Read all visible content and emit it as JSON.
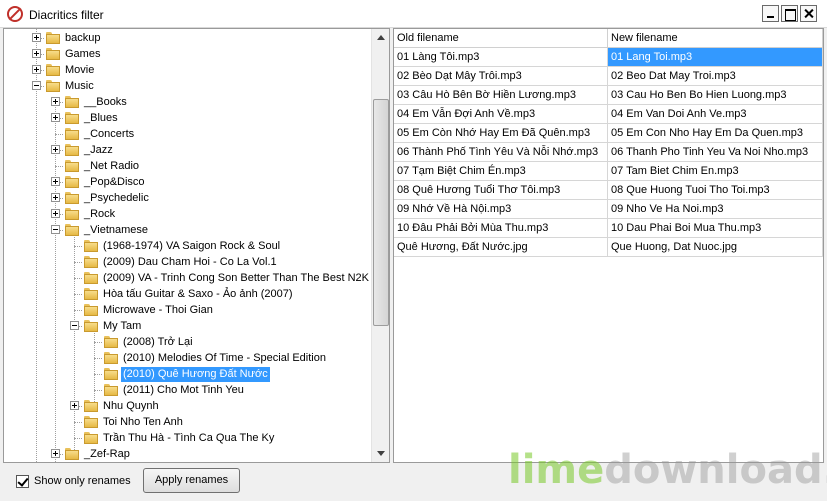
{
  "window": {
    "title": "Diacritics filter"
  },
  "colors": {
    "selection": "#3399ff",
    "folder": "#e6b945"
  },
  "tree": {
    "nodes": [
      {
        "label": "backup",
        "level": 1,
        "expander": "plus"
      },
      {
        "label": "Games",
        "level": 1,
        "expander": "plus"
      },
      {
        "label": "Movie",
        "level": 1,
        "expander": "plus"
      },
      {
        "label": "Music",
        "level": 1,
        "expander": "minus"
      },
      {
        "label": "__Books",
        "level": 2,
        "expander": "plus"
      },
      {
        "label": "_Blues",
        "level": 2,
        "expander": "plus"
      },
      {
        "label": "_Concerts",
        "level": 2,
        "expander": "none"
      },
      {
        "label": "_Jazz",
        "level": 2,
        "expander": "plus"
      },
      {
        "label": "_Net Radio",
        "level": 2,
        "expander": "none"
      },
      {
        "label": "_Pop&Disco",
        "level": 2,
        "expander": "plus"
      },
      {
        "label": "_Psychedelic",
        "level": 2,
        "expander": "plus"
      },
      {
        "label": "_Rock",
        "level": 2,
        "expander": "plus"
      },
      {
        "label": "_Vietnamese",
        "level": 2,
        "expander": "minus"
      },
      {
        "label": "(1968-1974) VA Saigon Rock & Soul",
        "level": 3,
        "expander": "none"
      },
      {
        "label": "(2009) Dau Cham Hoi - Co La Vol.1",
        "level": 3,
        "expander": "none"
      },
      {
        "label": "(2009) VA - Trinh Cong Son Better Than The Best N2K",
        "level": 3,
        "expander": "none"
      },
      {
        "label": "Hòa tấu Guitar & Saxo - Ảo ảnh (2007)",
        "level": 3,
        "expander": "none"
      },
      {
        "label": "Microwave - Thoi Gian",
        "level": 3,
        "expander": "none"
      },
      {
        "label": "My Tam",
        "level": 3,
        "expander": "minus"
      },
      {
        "label": "(2008) Trở Lại",
        "level": 4,
        "expander": "none"
      },
      {
        "label": "(2010) Melodies Of Time - Special Edition",
        "level": 4,
        "expander": "none"
      },
      {
        "label": "(2010) Quê Hương Đất Nước",
        "level": 4,
        "expander": "none",
        "selected": true
      },
      {
        "label": "(2011) Cho Mot Tinh Yeu",
        "level": 4,
        "expander": "none"
      },
      {
        "label": "Nhu Quynh",
        "level": 3,
        "expander": "plus"
      },
      {
        "label": "Toi Nho Ten Anh",
        "level": 3,
        "expander": "none"
      },
      {
        "label": "Trần Thu Hà - Tình Ca Qua The Ky",
        "level": 3,
        "expander": "none"
      },
      {
        "label": "_Zef-Rap",
        "level": 2,
        "expander": "plus"
      }
    ]
  },
  "grid": {
    "columns": [
      "Old filename",
      "New filename"
    ],
    "rows": [
      [
        "01 Làng Tôi.mp3",
        "01 Lang Toi.mp3"
      ],
      [
        "02 Bèo Dạt Mây Trôi.mp3",
        "02 Beo Dat May Troi.mp3"
      ],
      [
        "03 Câu Hò Bên Bờ Hiền Lương.mp3",
        "03 Cau Ho Ben Bo Hien Luong.mp3"
      ],
      [
        "04 Em Vẫn Đợi Anh Về.mp3",
        "04 Em Van Doi Anh Ve.mp3"
      ],
      [
        "05 Em Còn Nhớ Hay Em Đã Quên.mp3",
        "05 Em Con Nho Hay Em Da Quen.mp3"
      ],
      [
        "06 Thành Phố Tình Yêu Và Nỗi Nhớ.mp3",
        "06 Thanh Pho Tinh Yeu Va Noi Nho.mp3"
      ],
      [
        "07 Tạm Biệt Chim Én.mp3",
        "07 Tam Biet Chim En.mp3"
      ],
      [
        "08 Quê Hương Tuổi Thơ Tôi.mp3",
        "08 Que Huong Tuoi Tho Toi.mp3"
      ],
      [
        "09 Nhớ Về Hà Nội.mp3",
        "09 Nho Ve Ha Noi.mp3"
      ],
      [
        "10 Đâu Phải Bởi Mùa Thu.mp3",
        "10 Dau Phai Boi Mua Thu.mp3"
      ],
      [
        "Quê Hương, Đất Nước.jpg",
        "Que Huong, Dat Nuoc.jpg"
      ]
    ],
    "selected_cell": [
      0,
      1
    ]
  },
  "bottom": {
    "show_only_renames_label": "Show only renames",
    "show_only_renames_checked": true,
    "apply_label": "Apply renames"
  },
  "watermark": {
    "part1": "lime",
    "part2": "download.com"
  }
}
